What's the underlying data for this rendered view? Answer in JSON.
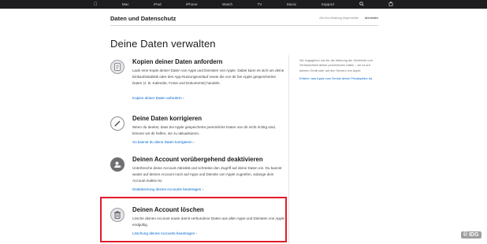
{
  "gnav": {
    "items": [
      "Mac",
      "iPad",
      "iPhone",
      "Watch",
      "TV",
      "Music",
      "Support"
    ],
    "icons": [
      "apple-logo",
      "search-icon",
      "bag-icon"
    ]
  },
  "local_nav": {
    "title": "Daten und Datenschutz",
    "signed_in_text": "Als Kris Waldung angemeldet",
    "sign_out": "Abmelden"
  },
  "page_title": "Deine Daten verwalten",
  "items": [
    {
      "title": "Kopien deiner Daten anfordern",
      "desc": "Lade eine Kopie deiner Daten von Apps und Diensten von Apple. Dabei kann es sich um deine Einkaufsstatistik oder den App-Nutzungsverlauf sowie die von dir bei Apple gespeicherten Daten (z. B. Kalender, Fotos und Dokumente) handeln.",
      "link": "Kopien deiner Daten anfordern ›",
      "icon": "document-icon"
    },
    {
      "title": "Deine Daten korrigieren",
      "desc": "Wenn du denkst, dass bei Apple gespeicherte persönliche Daten von dir nicht richtig sind, können wir dir helfen, sie zu aktualisieren.",
      "link": "So kannst du deine Daten korrigieren ›",
      "icon": "pencil-icon"
    },
    {
      "title": "Deinen Account vorübergehend deaktivieren",
      "desc": "Unterbreche deine Account-Aktivität und schränke den Zugriff auf deine Daten ein. Du kannst weder auf deinen Account noch auf Apps und Dienste von Apple zugreifen, solange dein Account inaktiv ist.",
      "link": "Deaktivierung deines Accounts beantragen ›",
      "icon": "user-pause-icon"
    },
    {
      "title": "Deinen Account löschen",
      "desc": "Lösche deinen Account sowie damit verbundene Daten aus allen Apps und Diensten von Apple endgültig.",
      "link": "Löschung deines Accounts beantragen ›",
      "icon": "trash-icon"
    }
  ],
  "sidebar": {
    "text": "Wir engagieren uns für die Wahrung der Sicherheit und Vertraulichkeit deiner persönlichen Daten – sie es auf deinem Gerät oder auf den Servern von Apple.",
    "link": "Erfahre, was Apple zum Schutz deiner Privatsphäre tut."
  },
  "watermark": "© IDG",
  "colors": {
    "highlight": "#e11c2c",
    "link": "#0066cc",
    "nav_bg": "#1d1d1f"
  }
}
